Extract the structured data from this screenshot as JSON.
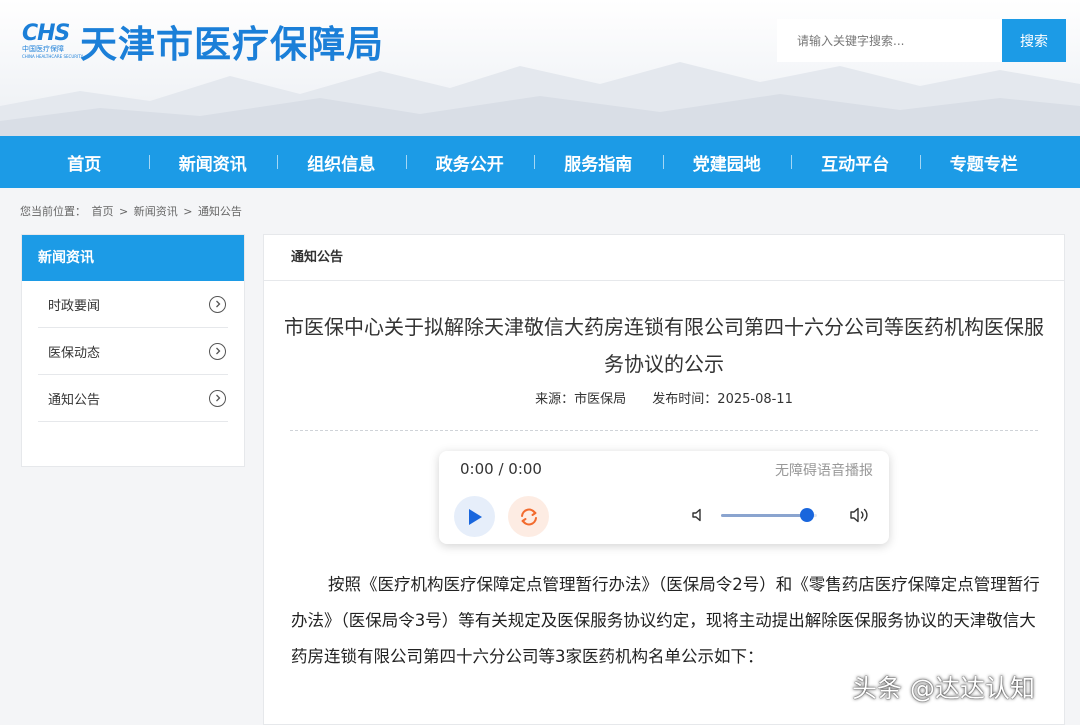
{
  "header": {
    "logo_abbr": "CHS",
    "logo_sub": "中国医疗保障",
    "logo_sub_en": "CHINA HEALTHCARE SECURITY",
    "site_title": "天津市医疗保障局",
    "search_placeholder": "请输入关键字搜索...",
    "search_button": "搜索"
  },
  "nav": {
    "items": [
      {
        "label": "首页"
      },
      {
        "label": "新闻资讯"
      },
      {
        "label": "组织信息"
      },
      {
        "label": "政务公开"
      },
      {
        "label": "服务指南"
      },
      {
        "label": "党建园地"
      },
      {
        "label": "互动平台"
      },
      {
        "label": "专题专栏"
      }
    ]
  },
  "breadcrumb": {
    "prefix": "您当前位置：",
    "items": [
      "首页",
      "新闻资讯",
      "通知公告"
    ],
    "separator": ">"
  },
  "sidebar": {
    "title": "新闻资讯",
    "items": [
      {
        "label": "时政要闻"
      },
      {
        "label": "医保动态"
      },
      {
        "label": "通知公告"
      }
    ]
  },
  "main": {
    "section_title": "通知公告",
    "article_title": "市医保中心关于拟解除天津敬信大药房连锁有限公司第四十六分公司等医药机构医保服务协议的公示",
    "source": "来源：市医保局",
    "publish_time": "发布时间：2025-08-11",
    "body": "按照《医疗机构医疗保障定点管理暂行办法》（医保局令2号）和《零售药店医疗保障定点管理暂行办法》（医保局令3号）等有关规定及医保服务协议约定，现将主动提出解除医保服务协议的天津敬信大药房连锁有限公司第四十六分公司等3家医药机构名单公示如下："
  },
  "player": {
    "time": "0:00 / 0:00",
    "label": "无障碍语音播报",
    "volume": 0.9
  },
  "watermark": "头条 @达达认知",
  "colors": {
    "primary": "#1c9be6",
    "logo_blue": "#1b7fd8",
    "play_accent": "#1966dd",
    "replay_accent": "#f26b2e"
  }
}
